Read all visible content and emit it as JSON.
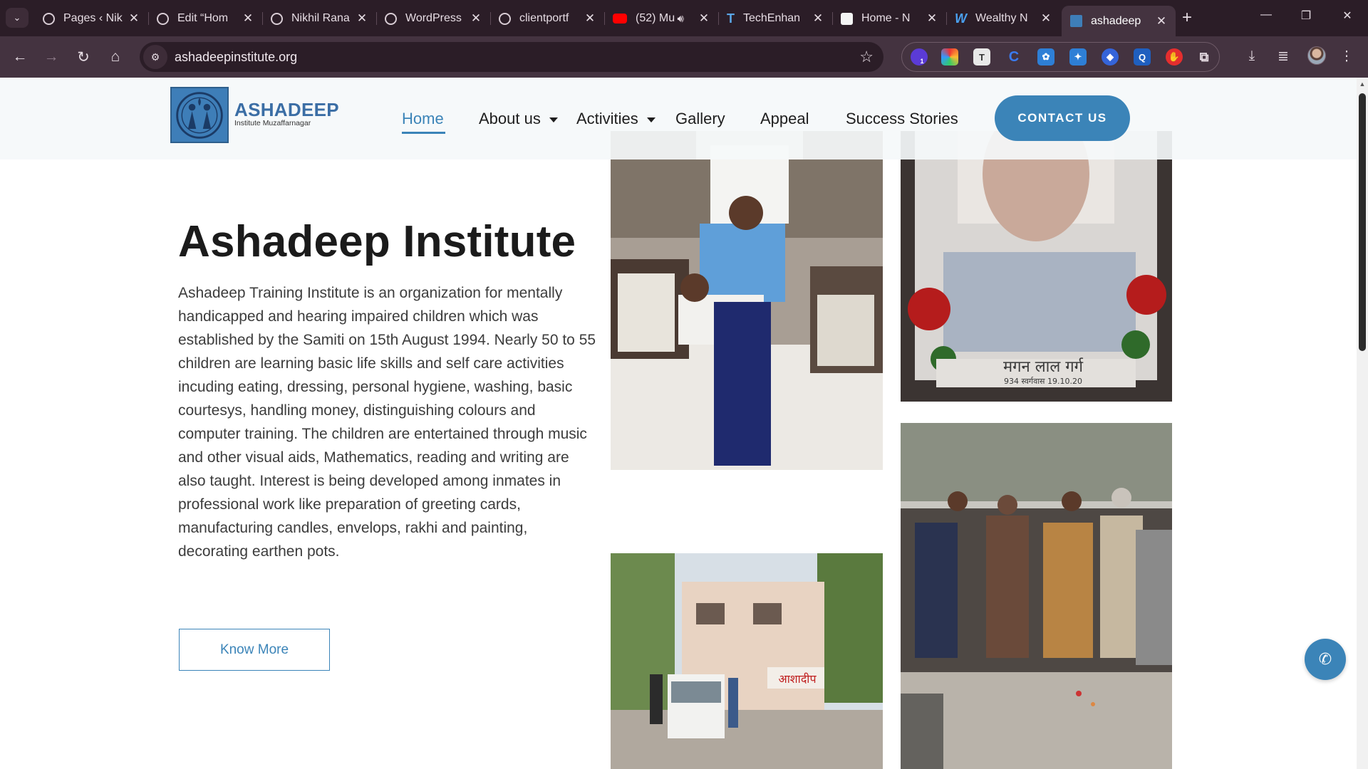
{
  "browser": {
    "tabs": [
      {
        "title": "Pages ‹ Nik",
        "favicon": "wordpress-icon"
      },
      {
        "title": "Edit “Hom",
        "favicon": "wordpress-icon"
      },
      {
        "title": "Nikhil Rana",
        "favicon": "wordpress-icon"
      },
      {
        "title": "WordPress",
        "favicon": "wordpress-icon"
      },
      {
        "title": "clientportf",
        "favicon": "wordpress-icon"
      },
      {
        "title": "(52) Mu",
        "favicon": "youtube-icon"
      },
      {
        "title": "TechEnhan",
        "favicon": "techenhance-icon"
      },
      {
        "title": "Home - N",
        "favicon": "site-icon"
      },
      {
        "title": "Wealthy N",
        "favicon": "w-icon"
      },
      {
        "title": "ashadeep",
        "favicon": "ashadeep-icon"
      }
    ],
    "url": "ashadeepinstitute.org",
    "extension_badge": "1"
  },
  "site": {
    "logo": {
      "title": "ASHADEEP",
      "subtitle": "Institute Muzaffarnagar"
    },
    "nav": {
      "home": "Home",
      "about": "About us",
      "activities": "Activities",
      "gallery": "Gallery",
      "appeal": "Appeal",
      "success": "Success Stories"
    },
    "contact_button": "CONTACT US"
  },
  "hero": {
    "title": "Ashadeep Institute",
    "body": "Ashadeep Training Institute is an organization for mentally handicapped and hearing impaired children which was established by the Samiti on 15th August 1994. Nearly 50 to 55 children are learning basic life skills and self care activities incuding eating, dressing, personal hygiene, washing, basic courtesys, handling money, distinguishing colours and computer training. The children are entertained through music and other visual aids, Mathematics, reading and writing are also taught. Interest is being developed among inmates in professional work like preparation of greeting cards, manufacturing candles, envelops, rakhi and painting, decorating earthen pots.",
    "button": "Know More"
  },
  "photos": {
    "memorial_caption": "मगन लाल गर्ग",
    "memorial_dates": "934  स्वर्गवास 19.10.20",
    "building_sign": "आशादीप"
  },
  "colors": {
    "accent": "#3b84b8",
    "browser_bg": "#2b1d27",
    "toolbar_bg": "#443340"
  }
}
